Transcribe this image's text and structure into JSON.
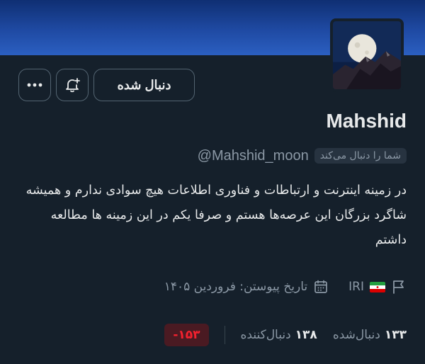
{
  "profile": {
    "name": "Mahshid",
    "handle": "@Mahshid_moon",
    "follows_you_badge": "شما را دنبال می‌کند",
    "bio": "در زمینه اینترنت و ارتباطات و فناوری اطلاعات هیچ سوادی ندارم و همیشه شاگرد بزرگان این عرصه‌ها هستم و صرفا یکم در این زمینه ها مطالعه داشتم",
    "location": "IRI",
    "location_flag": "iran-flag",
    "joined": "تاریخ پیوستن: فروردین ۱۴۰۵"
  },
  "actions": {
    "follow_label": "دنبال شده",
    "notify_icon": "bell-plus-icon",
    "more_icon": "more-icon"
  },
  "stats": {
    "following_count": "۱۳۳",
    "following_label": "دنبال‌شده",
    "followers_count": "۱۳۸",
    "followers_label": "دنبال‌کننده",
    "score": "-۱۵۳"
  },
  "colors": {
    "background": "#15202b",
    "banner": "#1f4aa3",
    "score_bg": "#4a1a22",
    "score_text": "#f4212e"
  }
}
